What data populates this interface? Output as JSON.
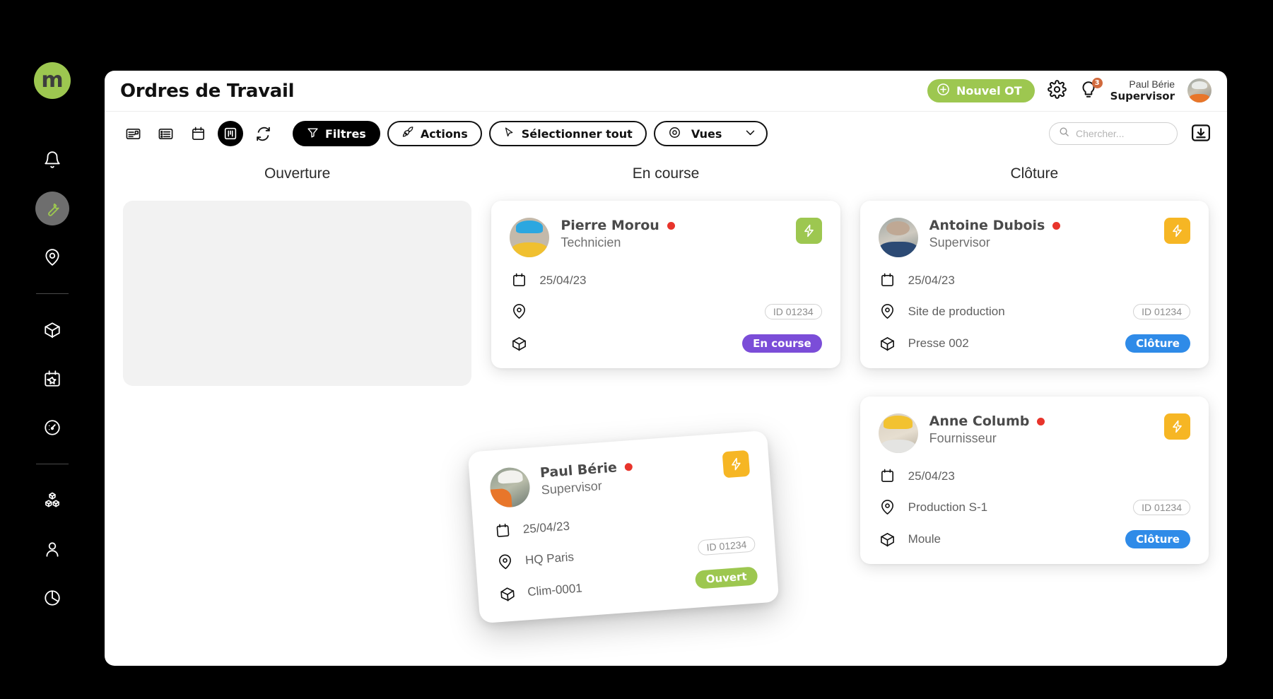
{
  "app": {
    "title": "Ordres de Travail",
    "logo_text": "m"
  },
  "header": {
    "new_button": "Nouvel OT",
    "new_button_color": "#9DC750",
    "settings_icon": "gear-icon",
    "notification_icon": "lightbulb-icon",
    "notification_badge": "3",
    "user_name": "Paul Bérie",
    "user_role": "Supervisor"
  },
  "toolbar": {
    "view_icons": [
      "card-view-icon",
      "list-view-icon",
      "calendar-view-icon",
      "kanban-view-icon",
      "refresh-icon"
    ],
    "active_view": "kanban-view-icon",
    "filters_label": "Filtres",
    "actions_label": "Actions",
    "select_all_label": "Sélectionner tout",
    "views_label": "Vues",
    "search_placeholder": "Chercher...",
    "download_icon": "download-icon"
  },
  "sidebar": {
    "items": [
      {
        "name": "notifications",
        "icon": "bell-icon",
        "active": false
      },
      {
        "name": "work-orders",
        "icon": "wrench-icon",
        "active": true
      },
      {
        "name": "locations",
        "icon": "map-pin-icon",
        "active": false
      },
      {
        "name": "assets",
        "icon": "box-icon",
        "active": false
      },
      {
        "name": "planning",
        "icon": "calendar-star-icon",
        "active": false
      },
      {
        "name": "performance",
        "icon": "gauge-icon",
        "active": false
      },
      {
        "name": "inventory",
        "icon": "cubes-icon",
        "active": false
      },
      {
        "name": "users",
        "icon": "person-icon",
        "active": false
      },
      {
        "name": "reports",
        "icon": "pie-chart-icon",
        "active": false
      }
    ]
  },
  "board": {
    "columns": [
      {
        "title": "Ouverture",
        "empty_dropzone": true,
        "cards": []
      },
      {
        "title": "En course",
        "empty_dropzone": false,
        "cards": [
          {
            "name": "Pierre Morou",
            "role": "Technicien",
            "avatar": "av-tech",
            "dot": "#e8342b",
            "bolt_color": "green",
            "date": "25/04/23",
            "location": "",
            "asset": "",
            "id_chip": "ID 01234",
            "status": "En course",
            "status_class": "st-encourse"
          }
        ]
      },
      {
        "title": "Clôture",
        "empty_dropzone": false,
        "cards": [
          {
            "name": "Antoine Dubois",
            "role": "Supervisor",
            "avatar": "av-sup",
            "dot": "#e8342b",
            "bolt_color": "amber",
            "date": "25/04/23",
            "location": "Site de production",
            "asset": "Presse 002",
            "id_chip": "ID 01234",
            "status": "Clôture",
            "status_class": "st-cloture"
          },
          {
            "name": "Anne Columb",
            "role": "Fournisseur",
            "avatar": "av-four",
            "dot": "#e8342b",
            "bolt_color": "amber",
            "date": "25/04/23",
            "location": "Production S-1",
            "asset": "Moule",
            "id_chip": "ID 01234",
            "status": "Clôture",
            "status_class": "st-cloture"
          }
        ]
      }
    ]
  },
  "drag_card": {
    "name": "Paul Bérie",
    "role": "Supervisor",
    "bolt_color": "amber",
    "date": "25/04/23",
    "location": "HQ Paris",
    "asset": "Clim-0001",
    "id_chip": "ID 01234",
    "status": "Ouvert",
    "status_class": "st-ouvert"
  },
  "colors": {
    "brand_green": "#9DC750",
    "amber": "#F6B624",
    "purple": "#7B4DD8",
    "blue": "#2F8BE8",
    "red_dot": "#e8342b",
    "badge_orange": "#d1693c"
  }
}
